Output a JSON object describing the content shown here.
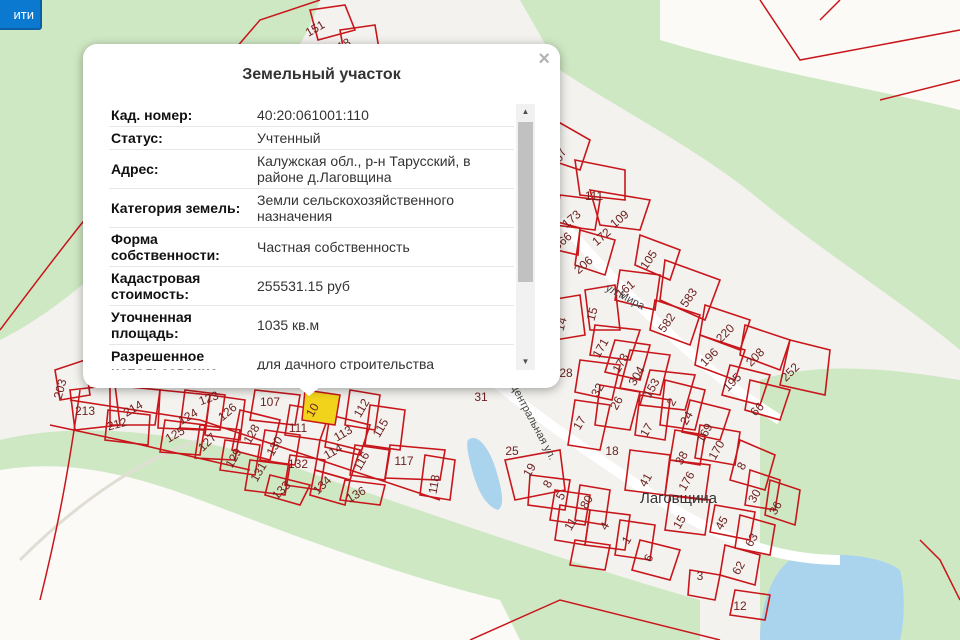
{
  "toolbar": {
    "button_label": "ити"
  },
  "popup": {
    "title": "Земельный участок",
    "close_glyph": "×",
    "rows": [
      {
        "label": "Кад. номер:",
        "value": "40:20:061001:110"
      },
      {
        "label": "Статус:",
        "value": "Учтенный"
      },
      {
        "label": "Адрес:",
        "value": "Калужская обл., р-н Тарусский, в районе д.Лаговщина"
      },
      {
        "label": "Категория земель:",
        "value": "Земли сельскохозяйственного назначения"
      },
      {
        "label": "Форма собственности:",
        "value": "Частная собственность"
      },
      {
        "label": "Кадастровая стоимость:",
        "value": "255531.15 руб"
      },
      {
        "label": "Уточненная площадь:",
        "value": "1035 кв.м"
      },
      {
        "label": "Разрешенное использование:",
        "value": "для дачного строительства"
      }
    ]
  },
  "map": {
    "colors": {
      "background": "#f3f2ee",
      "forest": "#cfe8c4",
      "water": "#aad3ee",
      "parcel_border": "#c8161b",
      "selected_parcel": "#f2d31c"
    },
    "streets": [
      "ул.Мира",
      "Центральная ул."
    ],
    "village": "Лаговщина",
    "parcel_numbers": [
      "151",
      "18",
      "107",
      "111",
      "109",
      "173",
      "172",
      "366",
      "206",
      "105",
      "161",
      "583",
      "582",
      "14",
      "15",
      "220",
      "208",
      "196",
      "171",
      "173",
      "195",
      "252",
      "304",
      "66",
      "28",
      "32",
      "153",
      "31",
      "26",
      "17",
      "17",
      "2",
      "24",
      "169",
      "25",
      "18",
      "38",
      "170",
      "19",
      "41",
      "176",
      "8",
      "8",
      "5",
      "80",
      "15",
      "30",
      "36",
      "11",
      "4",
      "45",
      "63",
      "1",
      "6",
      "62",
      "3",
      "12",
      "203",
      "213",
      "214",
      "212",
      "123",
      "124",
      "126",
      "107",
      "112",
      "125",
      "127",
      "128",
      "111",
      "113",
      "115",
      "129",
      "130",
      "114",
      "116",
      "131",
      "132",
      "117",
      "133",
      "134",
      "136",
      "118",
      "10"
    ]
  }
}
